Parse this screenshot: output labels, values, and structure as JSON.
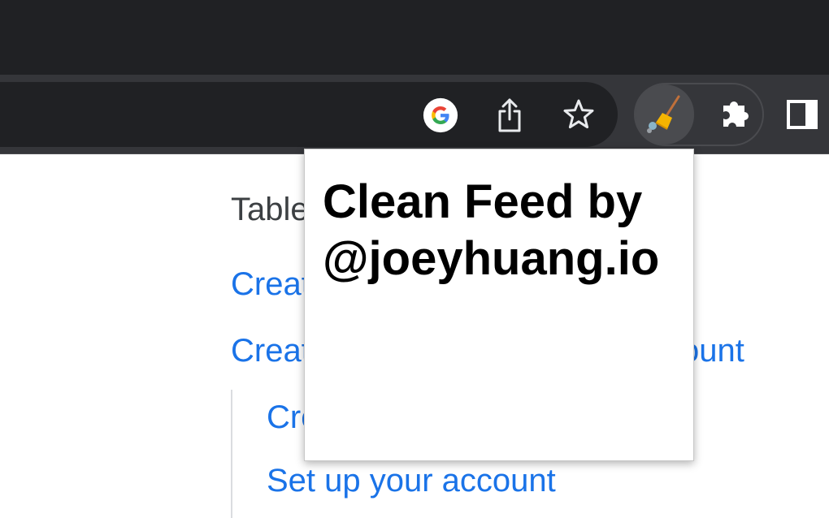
{
  "toolbar": {
    "icons": [
      "google-icon",
      "share-icon",
      "star-icon",
      "broom-icon",
      "puzzle-icon",
      "side-panel-icon"
    ],
    "colors": {
      "tabstrip": "#202124",
      "toolbar": "#35363a",
      "active_extension": "#4a4b4f"
    }
  },
  "page": {
    "toc_heading": "Table",
    "toc_items": [
      "Creat",
      "Creat",
      "count",
      "Cre",
      "Set up your account"
    ],
    "link_color": "#1a73e8"
  },
  "popup": {
    "title_line1": "Clean Feed by",
    "title_line2": "@joeyhuang.io"
  }
}
